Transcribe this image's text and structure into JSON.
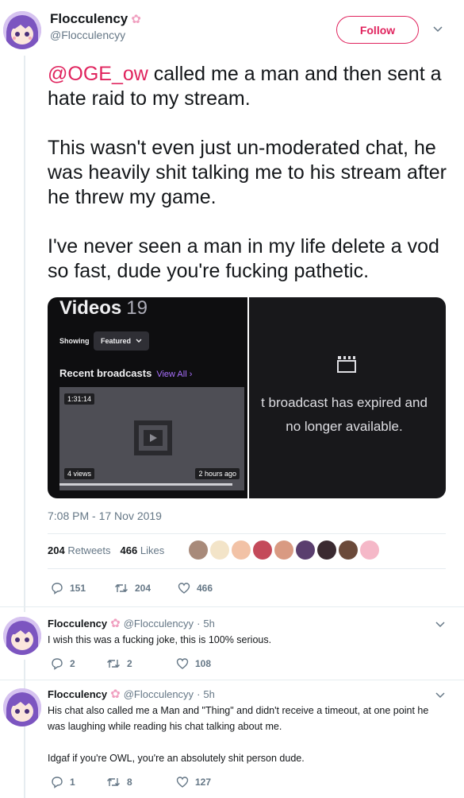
{
  "main_tweet": {
    "display_name": "Flocculency",
    "handle": "@Flocculencyy",
    "follow_label": "Follow",
    "mention": "@OGE_ow",
    "text_after_mention": " called me a man and then sent a hate raid to my stream.",
    "paragraph2": "This wasn't even just un-moderated chat, he was heavily shit talking me to his stream after he threw my game.",
    "paragraph3": "I've never seen a man in my life delete a vod so fast, dude you're fucking pathetic.",
    "timestamp": "7:08 PM - 17 Nov 2019",
    "retweets_count": "204",
    "retweets_label": "Retweets",
    "likes_count": "466",
    "likes_label": "Likes",
    "actions": {
      "replies": "151",
      "retweets": "204",
      "likes": "466"
    }
  },
  "media": {
    "left": {
      "title": "Videos",
      "count": "19",
      "showing_label": "Showing",
      "filter_value": "Featured",
      "section_title": "Recent broadcasts",
      "view_all": "View All",
      "duration": "1:31:14",
      "views": "4 views",
      "ago": "2 hours ago"
    },
    "right": {
      "line1": "t broadcast has expired and",
      "line2": "no longer available."
    }
  },
  "replies": [
    {
      "display_name": "Flocculency",
      "handle": "@Flocculencyy",
      "time": "5h",
      "text": "I wish this was a fucking joke, this is 100% serious.",
      "actions": {
        "replies": "2",
        "retweets": "2",
        "likes": "108"
      }
    },
    {
      "display_name": "Flocculency",
      "handle": "@Flocculencyy",
      "time": "5h",
      "text1": "His chat also called me a Man and \"Thing\" and didn't receive a timeout, at one point he was laughing while reading his chat talking about me.",
      "text2": "Idgaf if you're OWL, you're an absolutely shit person dude.",
      "actions": {
        "replies": "1",
        "retweets": "8",
        "likes": "127"
      }
    }
  ],
  "colors": {
    "accent": "#e0245e",
    "muted": "#657786",
    "twitch_purple": "#a970ff"
  }
}
